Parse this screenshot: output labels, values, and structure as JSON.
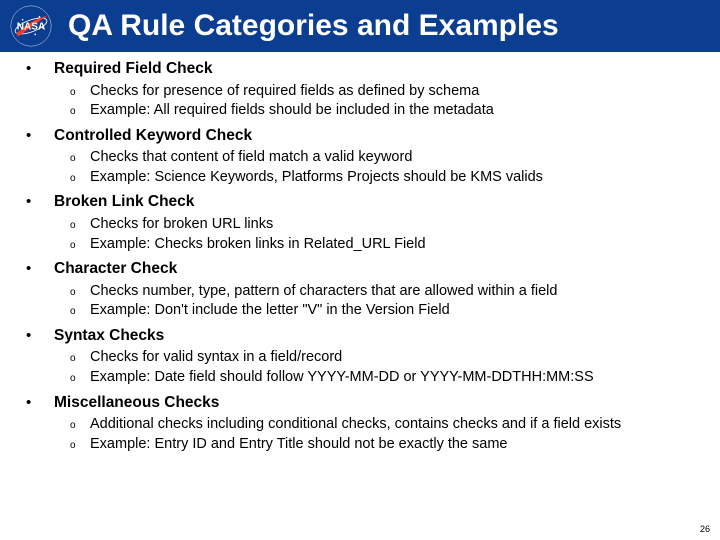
{
  "header": {
    "title": "QA Rule Categories and Examples",
    "logo_alt": "NASA logo"
  },
  "sub_bullet_glyph": "o",
  "sections": [
    {
      "heading": "Required Field Check",
      "items": [
        "Checks for presence of required fields as defined by schema",
        "Example: All required fields should be included in the metadata"
      ]
    },
    {
      "heading": "Controlled Keyword Check",
      "items": [
        "Checks that content of field match a valid keyword",
        "Example: Science Keywords, Platforms Projects should be KMS valids"
      ]
    },
    {
      "heading": "Broken Link Check",
      "items": [
        "Checks for broken URL links",
        "Example: Checks broken links in Related_URL Field"
      ]
    },
    {
      "heading": "Character Check",
      "items": [
        "Checks number, type, pattern of characters that are allowed within a field",
        "Example: Don't include the letter \"V\" in the Version Field"
      ]
    },
    {
      "heading": "Syntax Checks",
      "items": [
        "Checks for valid syntax in a field/record",
        "Example: Date field should follow YYYY-MM-DD or YYYY-MM-DDTHH:MM:SS"
      ]
    },
    {
      "heading": "Miscellaneous Checks",
      "items": [
        "Additional checks including conditional checks, contains checks and if a field exists",
        "Example: Entry ID and Entry Title should not be exactly the same"
      ]
    }
  ],
  "page_number": "26"
}
